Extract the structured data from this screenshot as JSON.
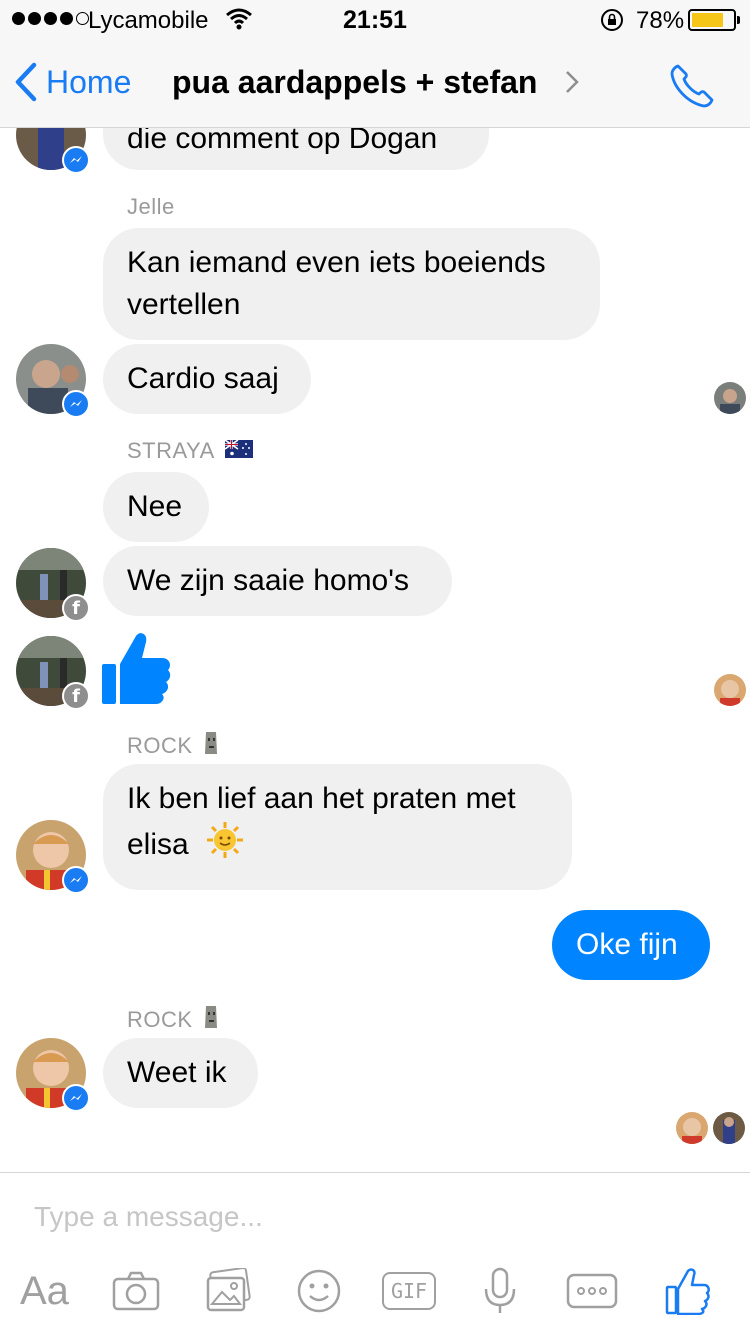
{
  "status_bar": {
    "carrier": "Lycamobile",
    "time": "21:51",
    "battery_percent": "78%",
    "battery_level": 0.78,
    "signal_bars_filled": 4,
    "signal_bars_total": 5
  },
  "nav": {
    "back_label": "Home",
    "title": "pua aardappels + stefan"
  },
  "messages": {
    "m0": "die comment op Dogan",
    "jelle_sender": "Jelle",
    "m1": "Kan iemand even iets boeiends vertellen",
    "m2": "Cardio saaj",
    "straya_sender": "STRAYA",
    "m3": "Nee",
    "m4": "We zijn saaie homo's",
    "rock_sender_1": "ROCK",
    "m6": "Ik ben lief aan het praten met elisa",
    "m7": "Oke fijn",
    "rock_sender_2": "ROCK",
    "m8": "Weet ik"
  },
  "compose": {
    "placeholder": "Type a message...",
    "aa_label": "Aa",
    "gif_label": "GIF"
  },
  "colors": {
    "accent": "#0084ff",
    "link": "#1a7cf2",
    "incoming_bubble": "#f1f0f0",
    "battery": "#f5c518"
  }
}
